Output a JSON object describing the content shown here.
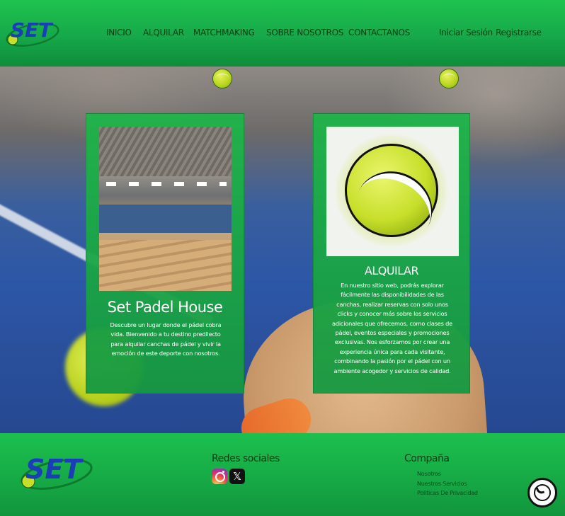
{
  "header": {
    "logo_text": "SET",
    "nav": [
      {
        "label": "INICIO"
      },
      {
        "label": "ALQUILAR"
      },
      {
        "label": "MATCHMAKING"
      },
      {
        "label": "SOBRE NOSOTROS"
      },
      {
        "label": "CONTACTANOS"
      }
    ],
    "login_label": "Iniciar Sesión",
    "register_label": "Registrarse"
  },
  "cards": [
    {
      "title": "Set Padel House",
      "text": "Descubre un lugar donde el pádel cobra vida. Bienvenido a tu destino predilecto para alquilar canchas de pádel y vivir la emoción de este deporte con nosotros."
    },
    {
      "title": "ALQUILAR",
      "text": "En nuestro sitio web, podrás explorar fácilmente las disponibilidades de las canchas, realizar reservas con solo unos clicks y conocer más sobre los servicios adicionales que ofrecemos, como clases de pádel, eventos especiales y promociones exclusivas. Nos esforzamos por crear una experiencia única para cada visitante, combinando la pasión por el pádel con un ambiente acogedor y servicios de calidad."
    }
  ],
  "footer": {
    "logo_text": "SET",
    "social_title": "Redes sociales",
    "x_glyph": "𝕏",
    "company_title": "Compaña",
    "company_links": [
      "Nosotros",
      "Nuestros Servicios",
      "Politicas De Privacidad"
    ]
  },
  "colors": {
    "brand_green": "#1cb84b",
    "logo_blue": "#1a3db8",
    "ball_yellow": "#c7df2a"
  },
  "icons": {
    "logo": "set-logo-icon",
    "instagram": "instagram-icon",
    "x": "x-twitter-icon",
    "whatsapp": "whatsapp-icon",
    "tennis_ball": "tennis-ball-icon"
  }
}
